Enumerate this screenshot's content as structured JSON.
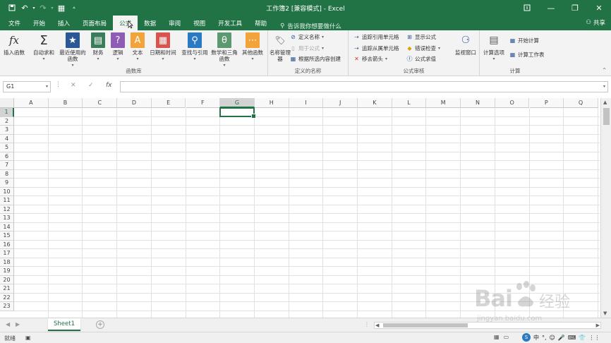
{
  "app": {
    "title": "工作簿2 [兼容模式] - Excel",
    "theme_color": "#217346"
  },
  "qat": {
    "save_icon": "save-icon",
    "undo_icon": "undo-icon",
    "redo_icon": "redo-icon",
    "form_icon": "form-icon",
    "customize_icon": "customize-icon"
  },
  "tabs": [
    "文件",
    "开始",
    "插入",
    "页面布局",
    "公式",
    "数据",
    "审阅",
    "视图",
    "开发工具",
    "帮助"
  ],
  "active_tab": "公式",
  "tellme": "告诉我你想要做什么",
  "share": "共享",
  "ribbon": {
    "groups": {
      "function_library": {
        "label": "函数库",
        "buttons": [
          "插入函数",
          "自动求和",
          "最近使用的函数",
          "财务",
          "逻辑",
          "文本",
          "日期和时间",
          "查找与引用",
          "数学和三角函数",
          "其他函数"
        ]
      },
      "defined_names": {
        "label": "定义的名称",
        "big": "名称管理器",
        "items": [
          "定义名称",
          "用于公式",
          "根据所选内容创建"
        ]
      },
      "formula_auditing": {
        "label": "公式审核",
        "items": [
          "追踪引用单元格",
          "追踪从属单元格",
          "移去箭头",
          "显示公式",
          "错误检查",
          "公式求值"
        ],
        "big": "监视窗口"
      },
      "calculation": {
        "label": "计算",
        "big": "计算选项",
        "items": [
          "开始计算",
          "计算工作表"
        ]
      }
    }
  },
  "formula_bar": {
    "name_box": "G1",
    "cancel": "✕",
    "enter": "✓",
    "fx": "fx",
    "value": ""
  },
  "grid": {
    "columns": [
      "A",
      "B",
      "C",
      "D",
      "E",
      "F",
      "G",
      "H",
      "I",
      "J",
      "K",
      "L",
      "M",
      "N",
      "O",
      "P",
      "Q"
    ],
    "rows": [
      "1",
      "2",
      "3",
      "4",
      "5",
      "6",
      "7",
      "8",
      "9",
      "10",
      "11",
      "12",
      "13",
      "14",
      "15",
      "16",
      "17",
      "18",
      "19",
      "20",
      "21",
      "22",
      "23"
    ],
    "selected_cell": "G1",
    "selected_col": "G",
    "selected_row": "1"
  },
  "sheets": [
    "Sheet1"
  ],
  "status": {
    "mode": "就绪",
    "ime": [
      "中",
      "°,",
      "☺",
      "🎤",
      "⌨",
      "👕",
      "⋮⋮"
    ]
  },
  "watermark": {
    "logo": "Bai",
    "text": "经验",
    "url": "jingyan.baidu.com"
  }
}
